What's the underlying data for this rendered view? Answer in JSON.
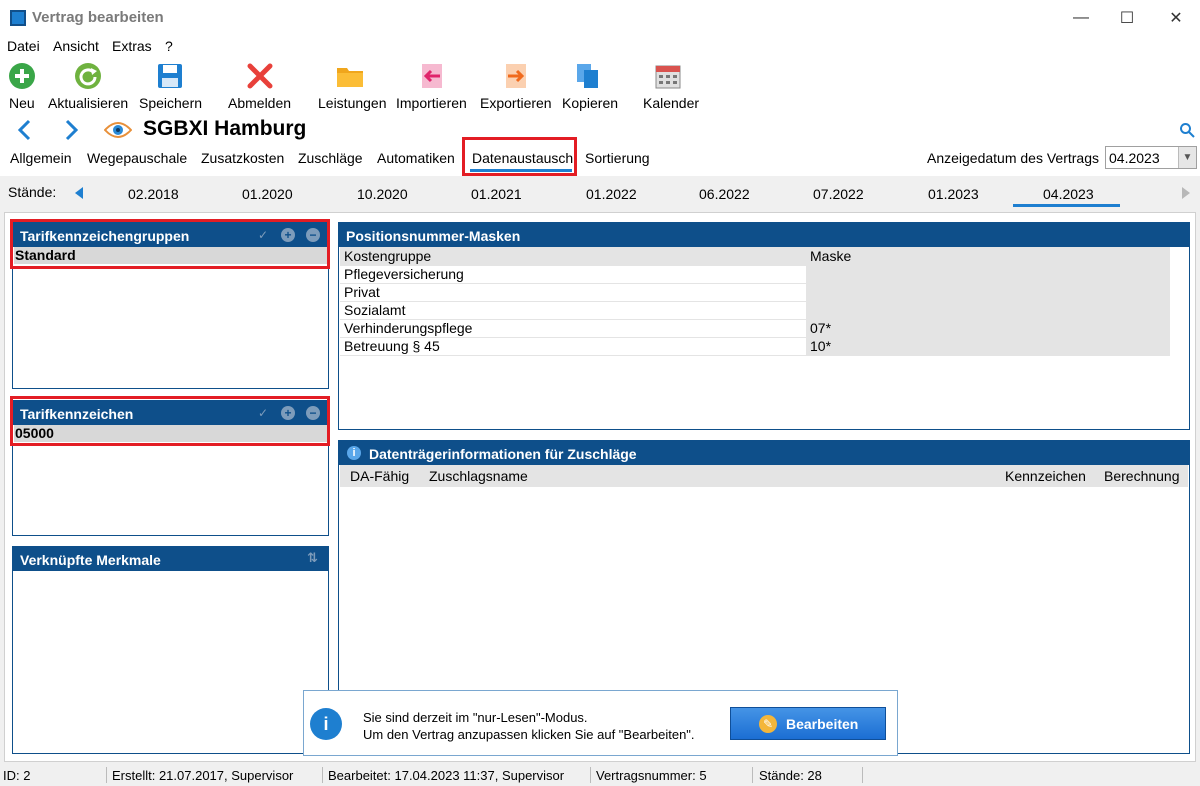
{
  "window": {
    "title": "Vertrag bearbeiten"
  },
  "menu": [
    "Datei",
    "Ansicht",
    "Extras",
    "?"
  ],
  "toolbar": [
    {
      "label": "Neu",
      "icon": "plus-circle-icon"
    },
    {
      "label": "Aktualisieren",
      "icon": "refresh-icon"
    },
    {
      "label": "Speichern",
      "icon": "floppy-disk-icon"
    },
    {
      "label": "Abmelden",
      "icon": "red-x-icon"
    },
    {
      "label": "Leistungen",
      "icon": "folder-icon"
    },
    {
      "label": "Importieren",
      "icon": "import-icon"
    },
    {
      "label": "Exportieren",
      "icon": "export-icon"
    },
    {
      "label": "Kopieren",
      "icon": "copy-icon"
    },
    {
      "label": "Kalender",
      "icon": "calendar-icon"
    }
  ],
  "header": {
    "title": "SGBXI Hamburg"
  },
  "tabs": [
    "Allgemein",
    "Wegepauschale",
    "Zusatzkosten",
    "Zuschläge",
    "Automatiken",
    "Datenaustausch",
    "Sortierung"
  ],
  "active_tab": "Datenaustausch",
  "anzeigedatum": {
    "label": "Anzeigedatum des Vertrags",
    "value": "04.2023"
  },
  "staende": {
    "label": "Stände:",
    "items": [
      "02.2018",
      "01.2020",
      "10.2020",
      "01.2021",
      "01.2022",
      "06.2022",
      "07.2022",
      "01.2023",
      "04.2023"
    ],
    "selected": "04.2023"
  },
  "tarifgruppen": {
    "title": "Tarifkennzeichengruppen",
    "selected": "Standard"
  },
  "tarifkennzeichen": {
    "title": "Tarifkennzeichen",
    "selected": "05000"
  },
  "merkmale": {
    "title": "Verknüpfte Merkmale"
  },
  "positionsmasken": {
    "title": "Positionsnummer-Masken",
    "columns": [
      "Kostengruppe",
      "Maske"
    ],
    "rows": [
      [
        "Pflegeversicherung",
        ""
      ],
      [
        "Privat",
        ""
      ],
      [
        "Sozialamt",
        ""
      ],
      [
        "Verhinderungspflege",
        "07*"
      ],
      [
        "Betreuung § 45",
        "10*"
      ]
    ]
  },
  "datentraeger": {
    "title": "Datenträgerinformationen für Zuschläge",
    "columns": [
      "DA-Fähig",
      "Zuschlagsname",
      "Kennzeichen",
      "Berechnung"
    ]
  },
  "info": {
    "line1": "Sie sind derzeit im \"nur-Lesen\"-Modus.",
    "line2": "Um den Vertrag anzupassen klicken Sie auf \"Bearbeiten\".",
    "button": "Bearbeiten"
  },
  "statusbar": {
    "id": "ID: 2",
    "erstellt": "Erstellt: 21.07.2017, Supervisor",
    "bearbeitet": "Bearbeitet: 17.04.2023 11:37, Supervisor",
    "vertragsnummer": "Vertragsnummer: 5",
    "staende": "Stände: 28"
  },
  "colors": {
    "header_blue": "#0e4f8a",
    "highlight_red": "#e31d24",
    "accent_blue": "#1e7fd0"
  }
}
